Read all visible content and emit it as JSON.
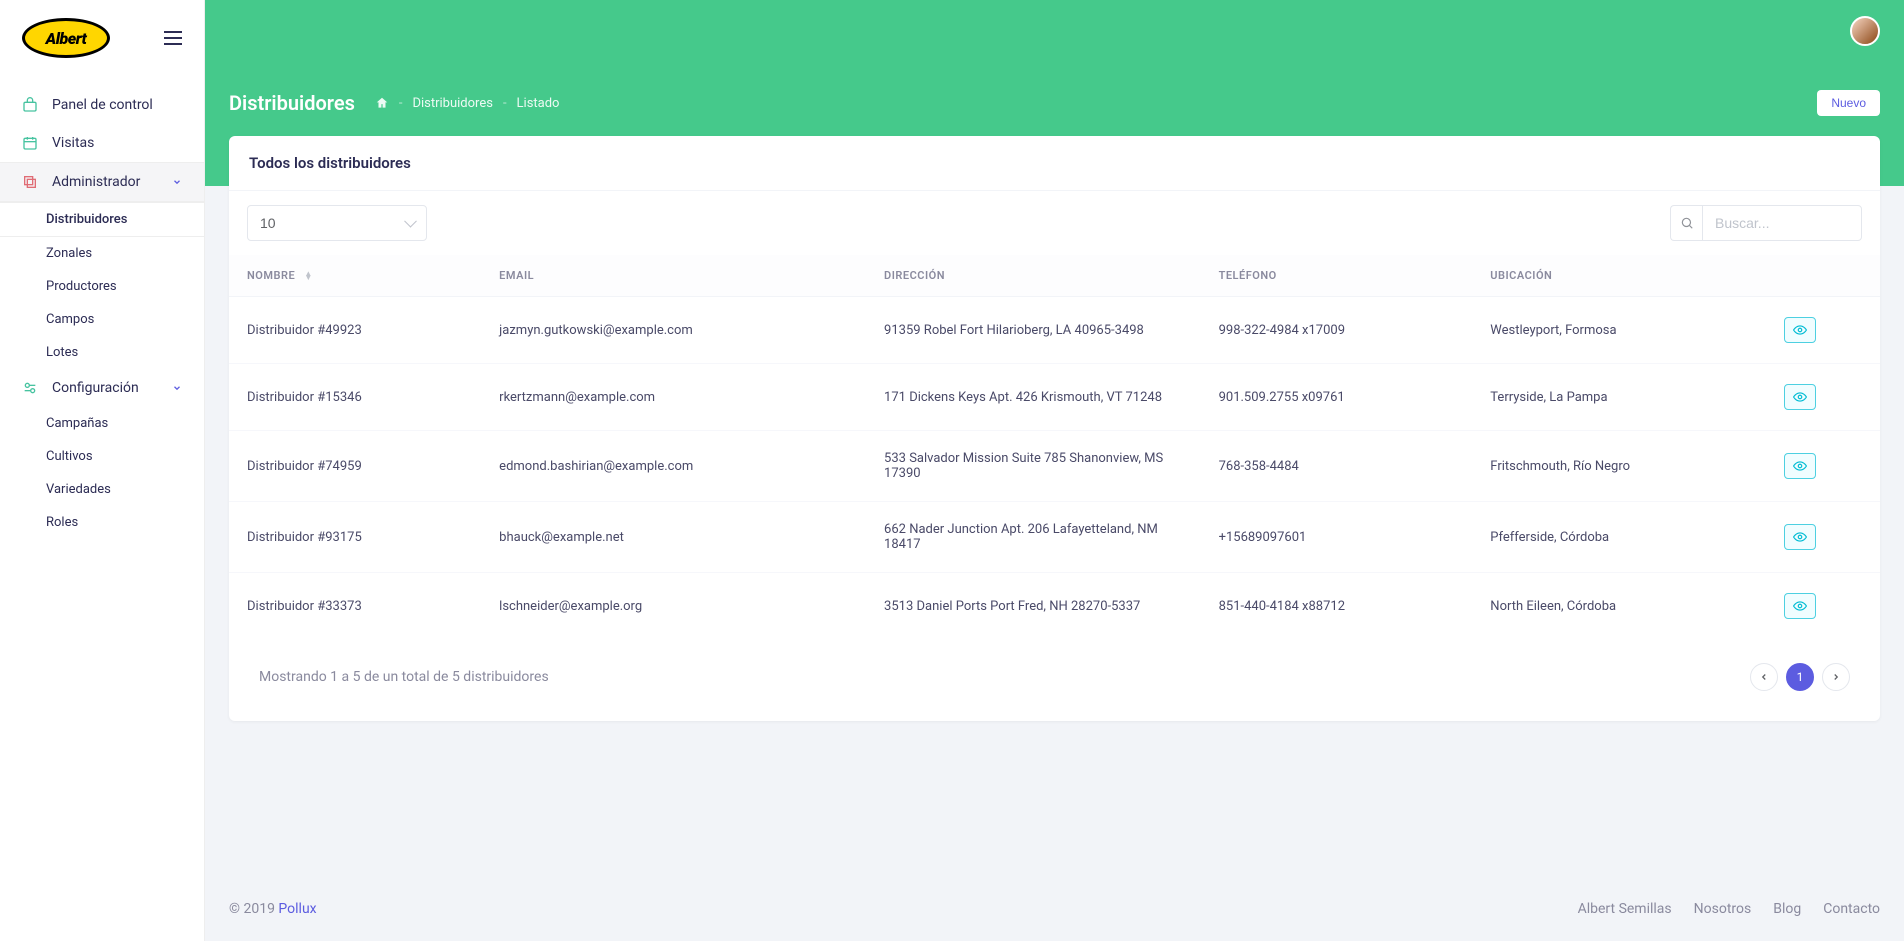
{
  "logo_text": "Albert",
  "sidebar": {
    "items": [
      {
        "icon": "dashboard",
        "label": "Panel de control"
      },
      {
        "icon": "calendar",
        "label": "Visitas"
      },
      {
        "icon": "admin",
        "label": "Administrador",
        "expanded": true,
        "active": true
      },
      {
        "icon": "config",
        "label": "Configuración",
        "expanded": true
      }
    ],
    "admin_sub": [
      {
        "label": "Distribuidores",
        "active": true
      },
      {
        "label": "Zonales"
      },
      {
        "label": "Productores"
      },
      {
        "label": "Campos"
      },
      {
        "label": "Lotes"
      }
    ],
    "config_sub": [
      {
        "label": "Campañas"
      },
      {
        "label": "Cultivos"
      },
      {
        "label": "Variedades"
      },
      {
        "label": "Roles"
      }
    ]
  },
  "header": {
    "title": "Distribuidores",
    "breadcrumb": {
      "home": "home",
      "distribuidores": "Distribuidores",
      "listado": "Listado"
    },
    "new_btn": "Nuevo"
  },
  "card": {
    "title": "Todos los distribuidores",
    "page_size": "10",
    "search_placeholder": "Buscar..."
  },
  "table": {
    "columns": {
      "nombre": "Nombre",
      "email": "Email",
      "direccion": "Dirección",
      "telefono": "Teléfono",
      "ubicacion": "Ubicación"
    },
    "rows": [
      {
        "nombre": "Distribuidor #49923",
        "email": "jazmyn.gutkowski@example.com",
        "direccion": "91359 Robel Fort Hilarioberg, LA 40965-3498",
        "telefono": "998-322-4984 x17009",
        "ubicacion": "Westleyport, Formosa"
      },
      {
        "nombre": "Distribuidor #15346",
        "email": "rkertzmann@example.com",
        "direccion": "171 Dickens Keys Apt. 426 Krismouth, VT 71248",
        "telefono": "901.509.2755 x09761",
        "ubicacion": "Terryside, La Pampa"
      },
      {
        "nombre": "Distribuidor #74959",
        "email": "edmond.bashirian@example.com",
        "direccion": "533 Salvador Mission Suite 785 Shanonview, MS 17390",
        "telefono": "768-358-4484",
        "ubicacion": "Fritschmouth, Río Negro"
      },
      {
        "nombre": "Distribuidor #93175",
        "email": "bhauck@example.net",
        "direccion": "662 Nader Junction Apt. 206 Lafayetteland, NM 18417",
        "telefono": "+15689097601",
        "ubicacion": "Pfefferside, Córdoba"
      },
      {
        "nombre": "Distribuidor #33373",
        "email": "lschneider@example.org",
        "direccion": "3513 Daniel Ports Port Fred, NH 28270-5337",
        "telefono": "851-440-4184 x88712",
        "ubicacion": "North Eileen, Córdoba"
      }
    ]
  },
  "pagination": {
    "info": "Mostrando 1 a 5 de un total de 5 distribuidores",
    "current": "1"
  },
  "footer": {
    "copyright": "© 2019 ",
    "brand": "Pollux",
    "links": [
      "Albert Semillas",
      "Nosotros",
      "Blog",
      "Contacto"
    ]
  }
}
